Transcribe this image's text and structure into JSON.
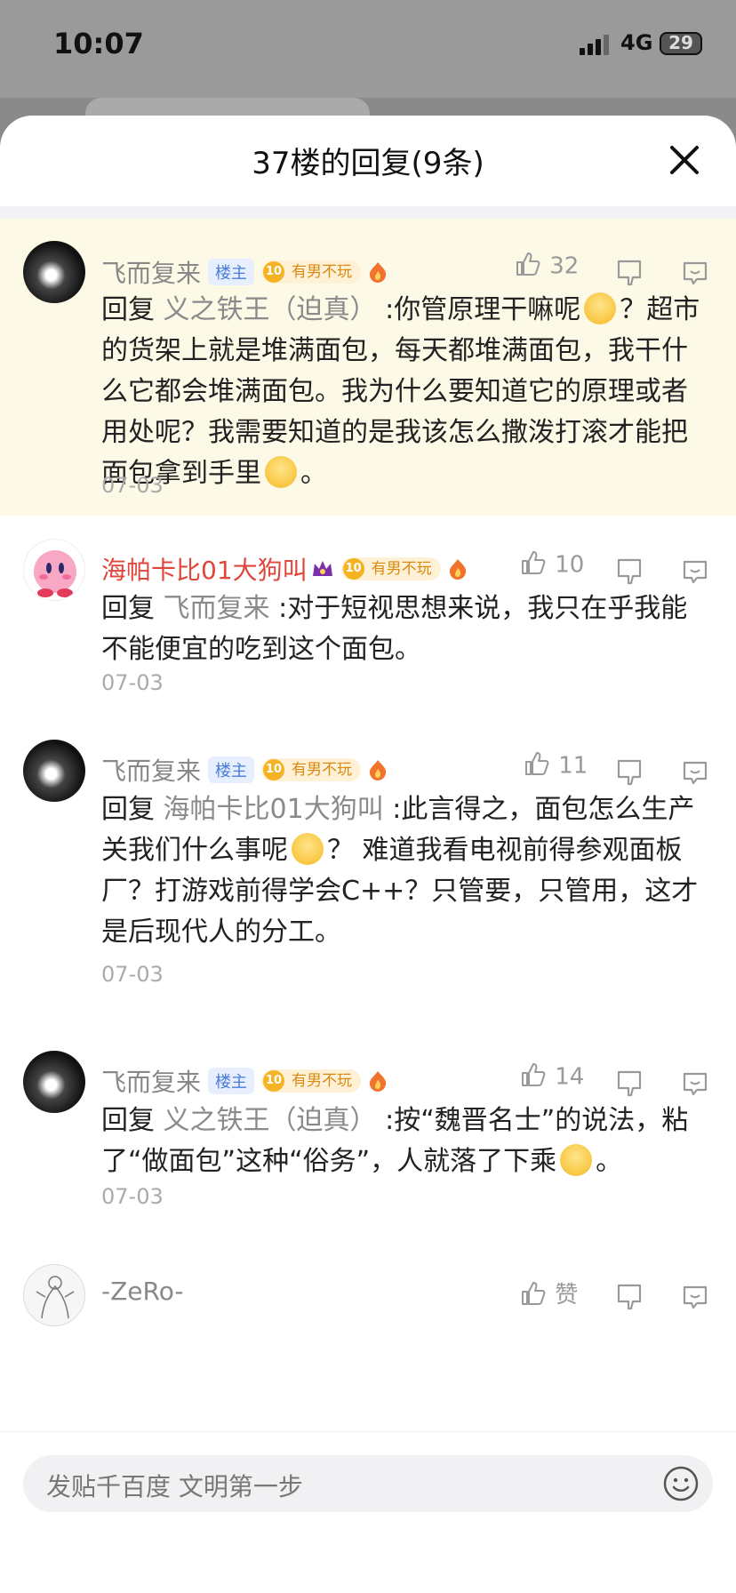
{
  "status": {
    "time": "10:07",
    "network": "4G",
    "battery": "29"
  },
  "sheet": {
    "title": "37楼的回复(9条)"
  },
  "comments": [
    {
      "name": "飞而复来",
      "owner_badge": "楼主",
      "level": "10",
      "level_title": "有男不玩",
      "likes": "32",
      "reply_prefix": "回复",
      "reply_target": "义之铁王（迫真）",
      "text_a": ":你管原理干嘛呢",
      "text_b": "？超市的货架上就是堆满面包，每天都堆满面包，我干什么它都会堆满面包。我为什么要知道它的原理或者用处呢？我需要知道的是我该怎么撒泼打滚才能把面包拿到手里",
      "text_c": "。",
      "date": "07-03"
    },
    {
      "name": "海帕卡比01大狗叫",
      "level": "10",
      "level_title": "有男不玩",
      "likes": "10",
      "reply_prefix": "回复",
      "reply_target": "飞而复来",
      "text_a": ":对于短视思想来说，我只在乎我能不能便宜的吃到这个面包。",
      "date": "07-03"
    },
    {
      "name": "飞而复来",
      "owner_badge": "楼主",
      "level": "10",
      "level_title": "有男不玩",
      "likes": "11",
      "reply_prefix": "回复",
      "reply_target": "海帕卡比01大狗叫",
      "text_a": ":此言得之，面包怎么生产关我们什么事呢",
      "text_b": "？ 难道我看电视前得参观面板厂？打游戏前得学会C++？只管要，只管用，这才是后现代人的分工。",
      "date": "07-03"
    },
    {
      "name": "飞而复来",
      "owner_badge": "楼主",
      "level": "10",
      "level_title": "有男不玩",
      "likes": "14",
      "reply_prefix": "回复",
      "reply_target": "义之铁王（迫真）",
      "text_a": ":按“魏晋名士”的说法，粘了“做面包”这种“俗务”，人就落了下乘",
      "text_b": "。",
      "date": "07-03"
    },
    {
      "name": "-ZeRo-",
      "likes": "赞"
    }
  ],
  "input": {
    "placeholder": "发贴千百度 文明第一步"
  },
  "colors": {
    "highlight": "#fdf9e7",
    "name_red": "#e0463b",
    "owner_badge": "#4a7cd9",
    "level_gold": "#f5b323"
  }
}
